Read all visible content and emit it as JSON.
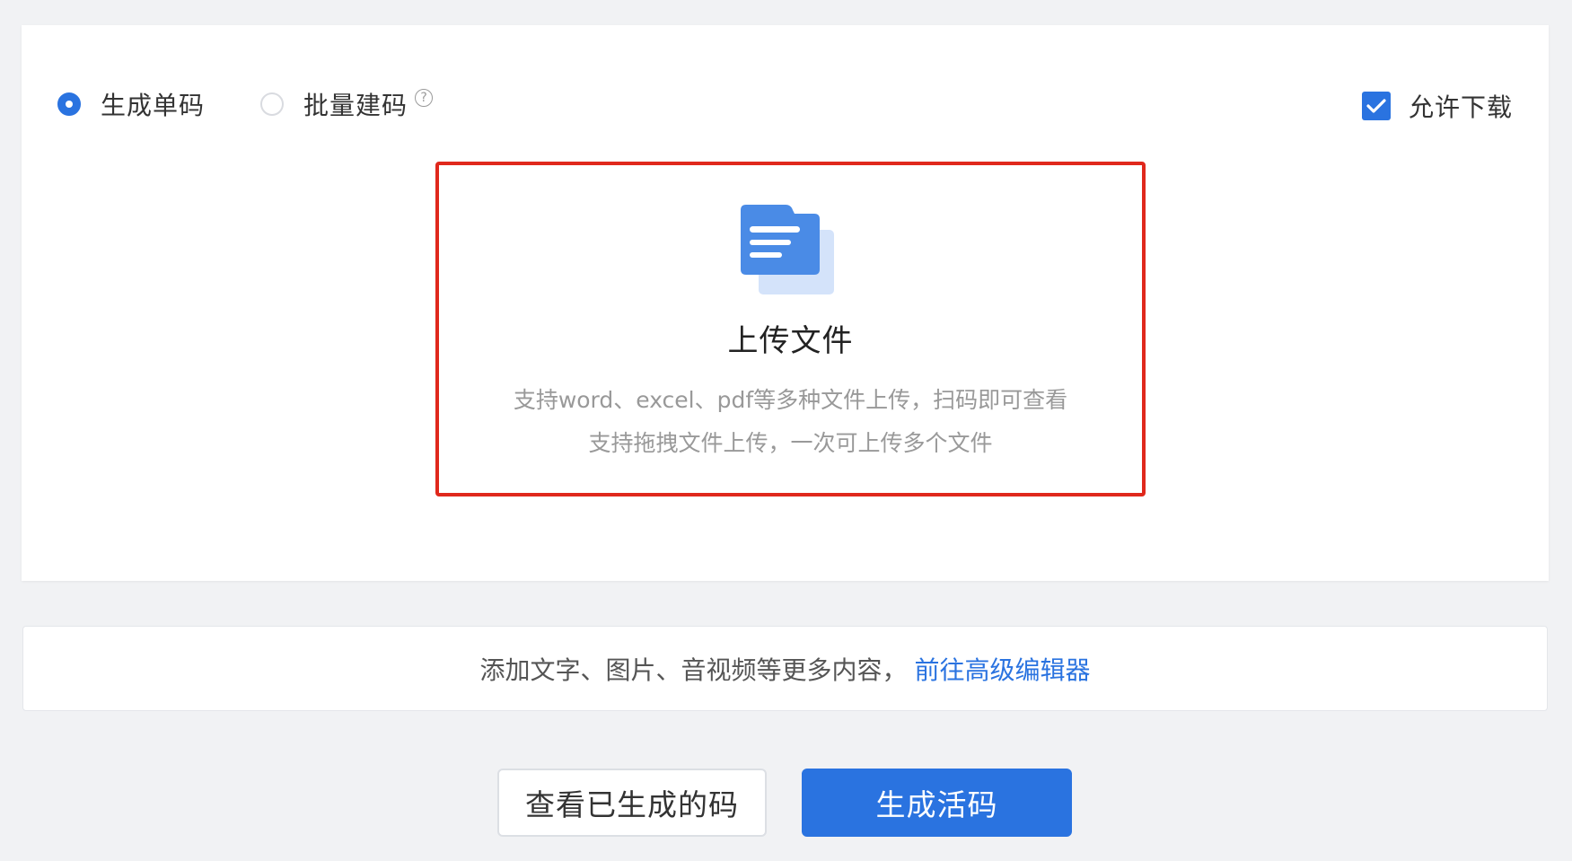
{
  "mode": {
    "single_label": "生成单码",
    "single_selected": true,
    "batch_label": "批量建码",
    "batch_selected": false,
    "help_glyph": "?"
  },
  "download": {
    "label": "允许下载",
    "checked": true
  },
  "upload": {
    "icon": "document-folder-icon",
    "title": "上传文件",
    "desc_line1": "支持word、excel、pdf等多种文件上传，扫码即可查看",
    "desc_line2": "支持拖拽文件上传，一次可上传多个文件"
  },
  "editor": {
    "text": "添加文字、图片、音视频等更多内容，",
    "link": "前往高级编辑器"
  },
  "actions": {
    "view_generated": "查看已生成的码",
    "generate": "生成活码"
  },
  "colors": {
    "primary": "#2a73e0",
    "highlight_border": "#e0281c",
    "page_background": "#f1f2f4"
  }
}
